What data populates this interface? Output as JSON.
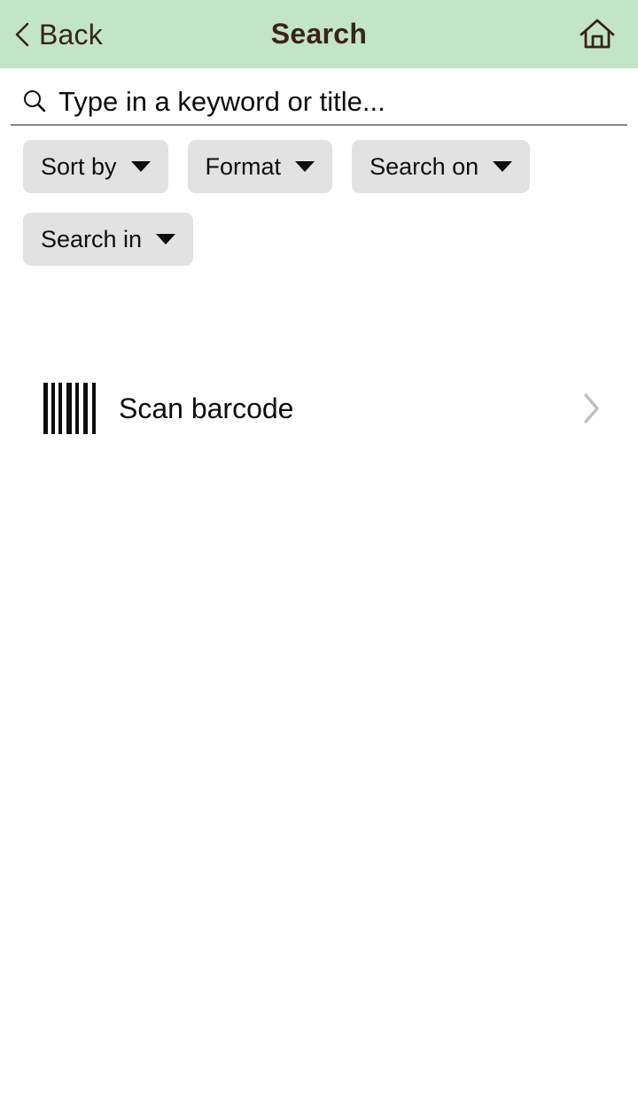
{
  "header": {
    "back_label": "Back",
    "title": "Search",
    "back_icon": "chevron-left-icon",
    "home_icon": "home-icon",
    "background_color": "#c2e5c8",
    "text_color": "#3a2318"
  },
  "search": {
    "placeholder": "Type in a keyword or title...",
    "value": "",
    "icon": "search-icon"
  },
  "filters": {
    "chips": [
      {
        "label": "Sort by",
        "icon": "chevron-down-icon"
      },
      {
        "label": "Format",
        "icon": "chevron-down-icon"
      },
      {
        "label": "Search on",
        "icon": "chevron-down-icon"
      },
      {
        "label": "Search in",
        "icon": "chevron-down-icon"
      }
    ],
    "chip_background_color": "#e2e2e2"
  },
  "actions": {
    "scan": {
      "label": "Scan barcode",
      "leading_icon": "barcode-icon",
      "trailing_icon": "chevron-right-icon"
    }
  }
}
